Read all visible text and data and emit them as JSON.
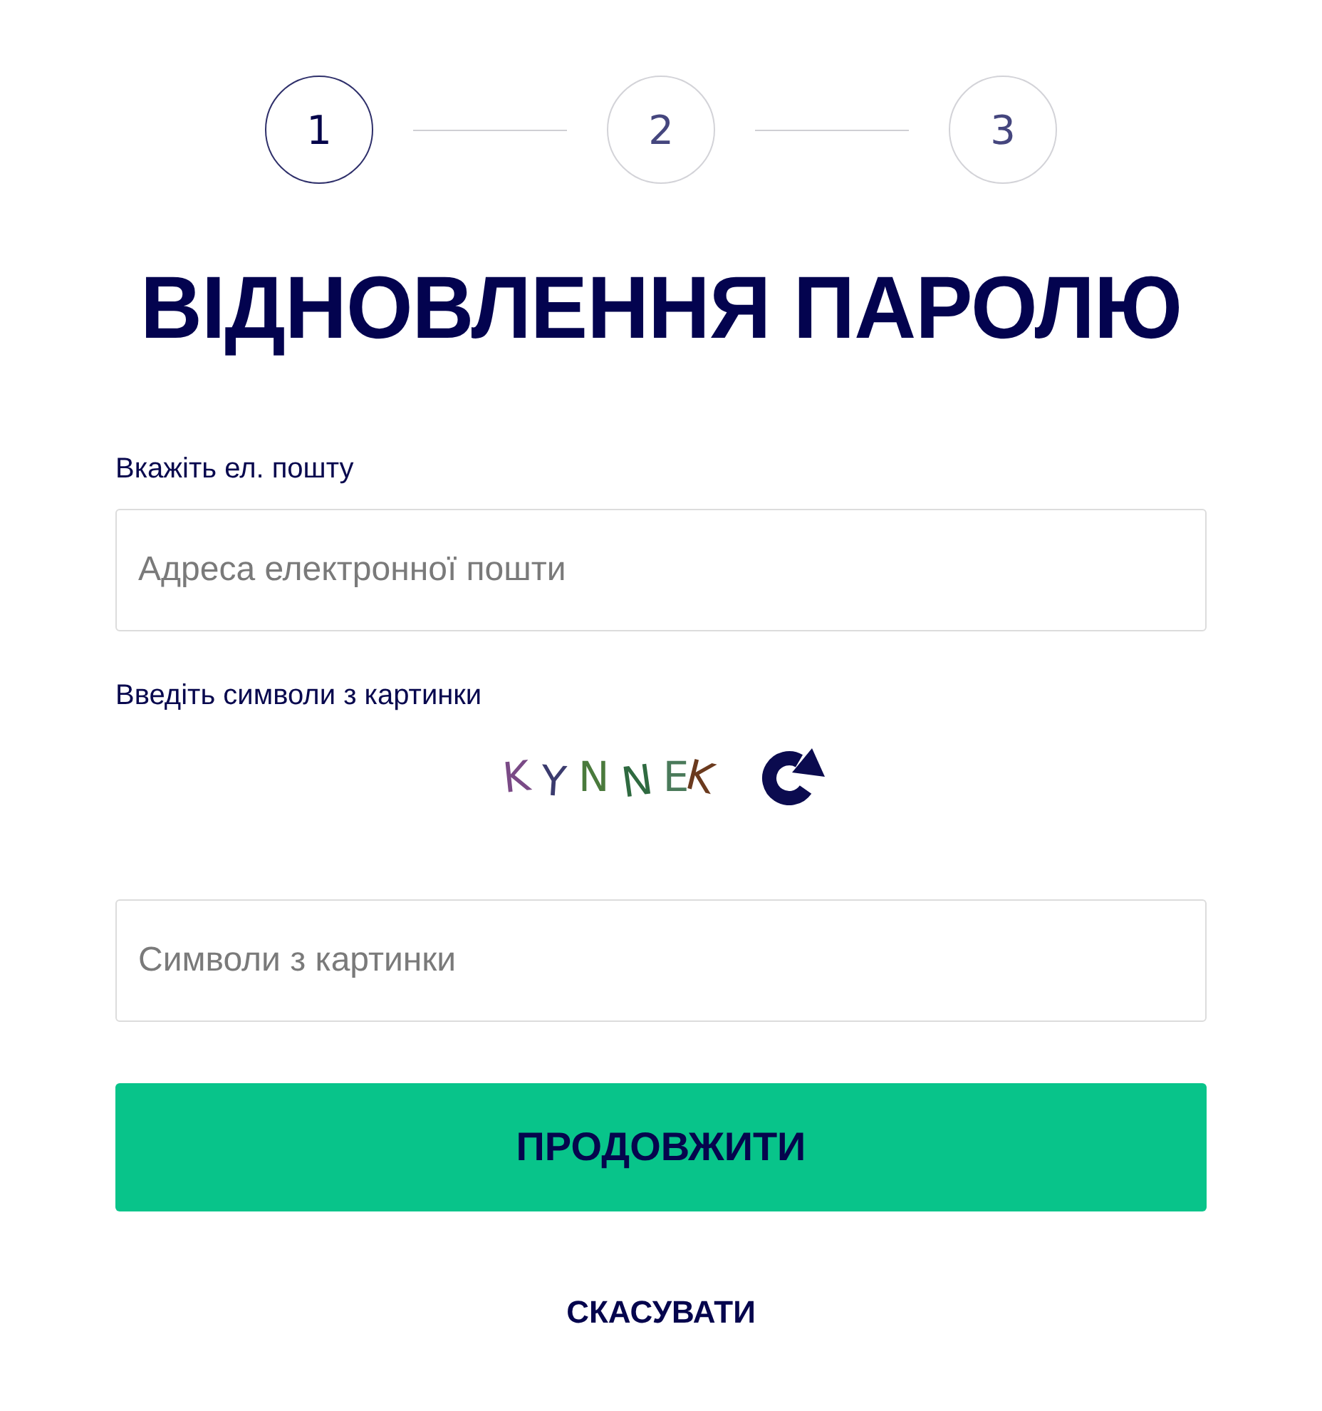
{
  "stepper": {
    "steps": [
      {
        "label": "1",
        "selected": true
      },
      {
        "label": "2",
        "selected": false
      },
      {
        "label": "3",
        "selected": false
      }
    ]
  },
  "title": "ВІДНОВЛЕННЯ ПАРОЛЮ",
  "email": {
    "label": "Вкажіть ел. пошту",
    "placeholder": "Адреса електронної пошти"
  },
  "captcha": {
    "label": "Введіть символи з картинки",
    "image_text": "KYNNEK",
    "placeholder": "Символи з картинки"
  },
  "submit_button": "ПРОДОВЖИТИ",
  "cancel_link": "СКАСУВАТИ"
}
